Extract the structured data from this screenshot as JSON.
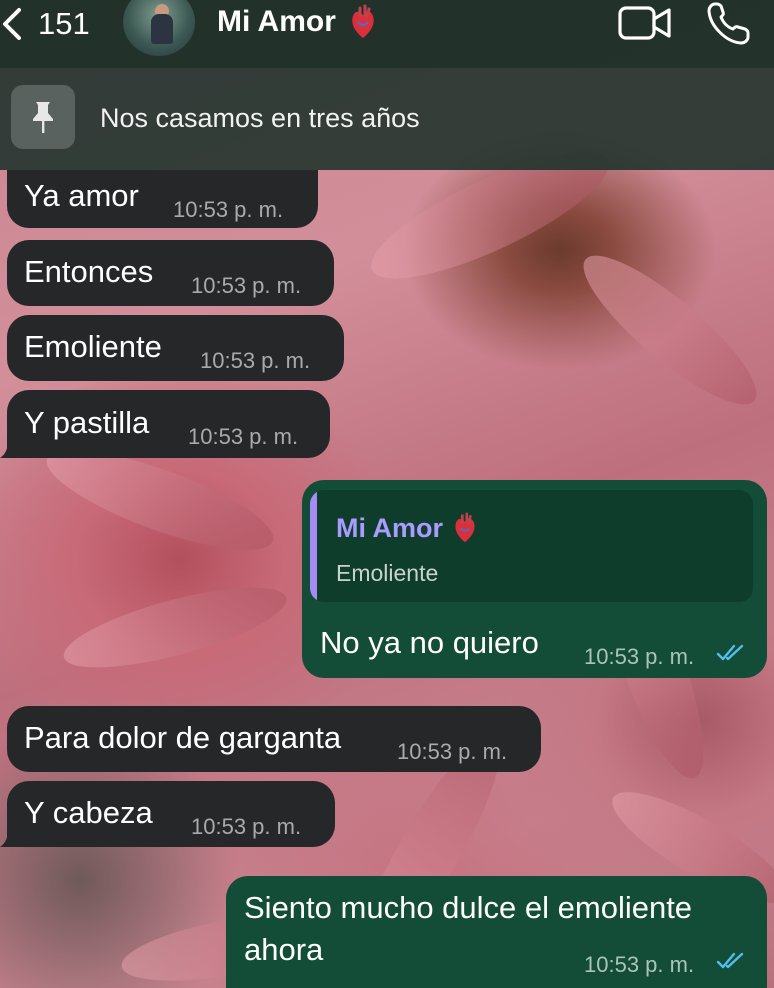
{
  "header": {
    "back_count": "151",
    "contact_name": "Mi Amor",
    "contact_emoji": "anatomical-heart-icon",
    "actions": [
      "video-call-icon",
      "phone-call-icon"
    ]
  },
  "pinned": {
    "icon": "pin-icon",
    "text": "Nos casamos en tres años"
  },
  "messages": [
    {
      "direction": "in",
      "text": "Ya amor",
      "time": "10:53 p. m."
    },
    {
      "direction": "in",
      "text": "Entonces",
      "time": "10:53 p. m."
    },
    {
      "direction": "in",
      "text": "Emoliente",
      "time": "10:53 p. m."
    },
    {
      "direction": "in",
      "text": "Y pastilla",
      "time": "10:53 p. m."
    },
    {
      "direction": "out",
      "reply_to": {
        "name": "Mi Amor",
        "text": "Emoliente"
      },
      "text": "No ya no quiero",
      "time": "10:53 p. m.",
      "status": "read"
    },
    {
      "direction": "in",
      "text": "Para dolor de garganta",
      "time": "10:53 p. m."
    },
    {
      "direction": "in",
      "text": "Y cabeza",
      "time": "10:53 p. m."
    },
    {
      "direction": "out",
      "text_lines": [
        "Siento mucho dulce el emoliente",
        "ahora"
      ],
      "time": "10:53 p. m.",
      "status": "read"
    }
  ],
  "colors": {
    "header_bg": "#142a22",
    "incoming_bubble": "#252728",
    "outgoing_bubble": "#134d37",
    "read_ticks": "#53bdeb",
    "quote_name": "#a99bff"
  }
}
